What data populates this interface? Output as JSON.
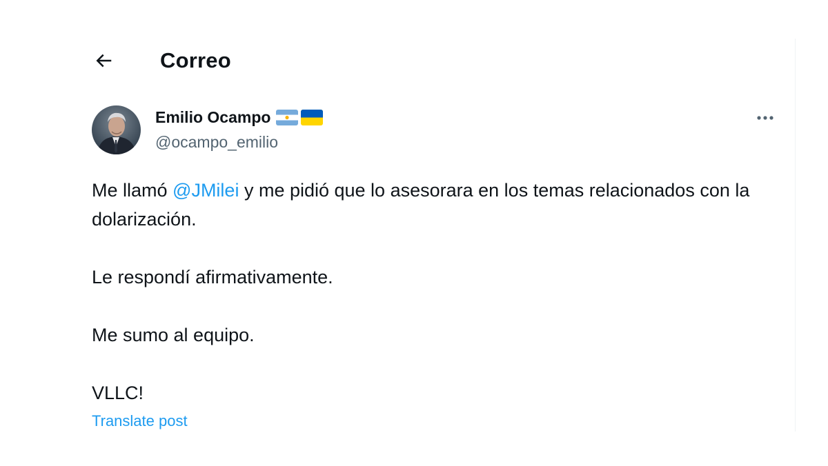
{
  "header": {
    "title": "Correo",
    "back_icon": "arrow-left-icon"
  },
  "author": {
    "display_name": "Emilio Ocampo",
    "handle": "@ocampo_emilio",
    "flags": [
      "argentina-flag-icon",
      "ukraine-flag-icon"
    ],
    "more_icon": "more-horizontal-icon"
  },
  "tweet": {
    "line1_prefix": "Me llamó ",
    "mention": "@JMilei",
    "line1_suffix": " y me pidió que lo asesorara en los temas relacionados con la dolarización.",
    "paragraph2": "Le respondí afirmativamente.",
    "paragraph3": "Me sumo al equipo.",
    "paragraph4": "VLLC!"
  },
  "translate_label": "Translate post",
  "colors": {
    "accent": "#1d9bf0",
    "text_primary": "#0f1419",
    "text_secondary": "#536471"
  }
}
